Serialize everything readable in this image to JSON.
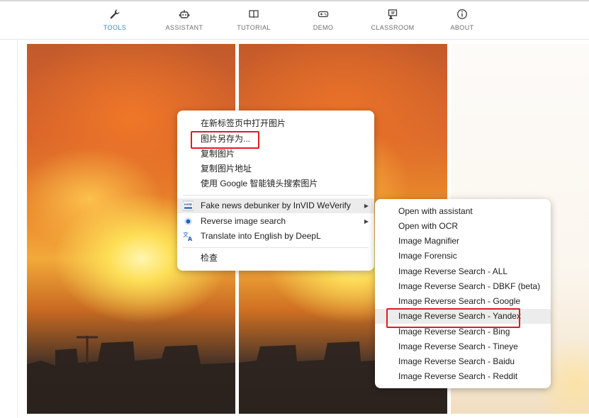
{
  "nav": {
    "items": [
      {
        "label": "TOOLS",
        "icon": "wrench-icon"
      },
      {
        "label": "ASSISTANT",
        "icon": "robot-icon"
      },
      {
        "label": "TUTORIAL",
        "icon": "book-icon"
      },
      {
        "label": "DEMO",
        "icon": "gamepad-icon"
      },
      {
        "label": "CLASSROOM",
        "icon": "classroom-icon"
      },
      {
        "label": "ABOUT",
        "icon": "info-icon"
      }
    ],
    "active_color": "#3a8ab8"
  },
  "context_menu": {
    "items": [
      {
        "label": "在新标签页中打开图片"
      },
      {
        "label": "图片另存为..."
      },
      {
        "label": "复制图片"
      },
      {
        "label": "复制图片地址"
      },
      {
        "label": "使用 Google 智能镜头搜索图片"
      },
      {
        "label": "Fake news debunker by InVID  WeVerify",
        "icon": "invid-icon",
        "icon_text": "InVID"
      },
      {
        "label": "Reverse image search",
        "icon": "reverse-search-icon"
      },
      {
        "label": "Translate into English by DeepL",
        "icon": "translate-icon"
      },
      {
        "label": "检查"
      }
    ]
  },
  "submenu": {
    "items": [
      {
        "label": "Open with assistant"
      },
      {
        "label": "Open with OCR"
      },
      {
        "label": "Image Magnifier"
      },
      {
        "label": "Image Forensic"
      },
      {
        "label": "Image Reverse Search - ALL"
      },
      {
        "label": "Image Reverse Search - DBKF (beta)"
      },
      {
        "label": "Image Reverse Search - Google"
      },
      {
        "label": "Image Reverse Search - Yandex"
      },
      {
        "label": "Image Reverse Search - Bing"
      },
      {
        "label": "Image Reverse Search - Tineye"
      },
      {
        "label": "Image Reverse Search - Baidu"
      },
      {
        "label": "Image Reverse Search - Reddit"
      }
    ]
  },
  "annotation_color": "#e01b24"
}
